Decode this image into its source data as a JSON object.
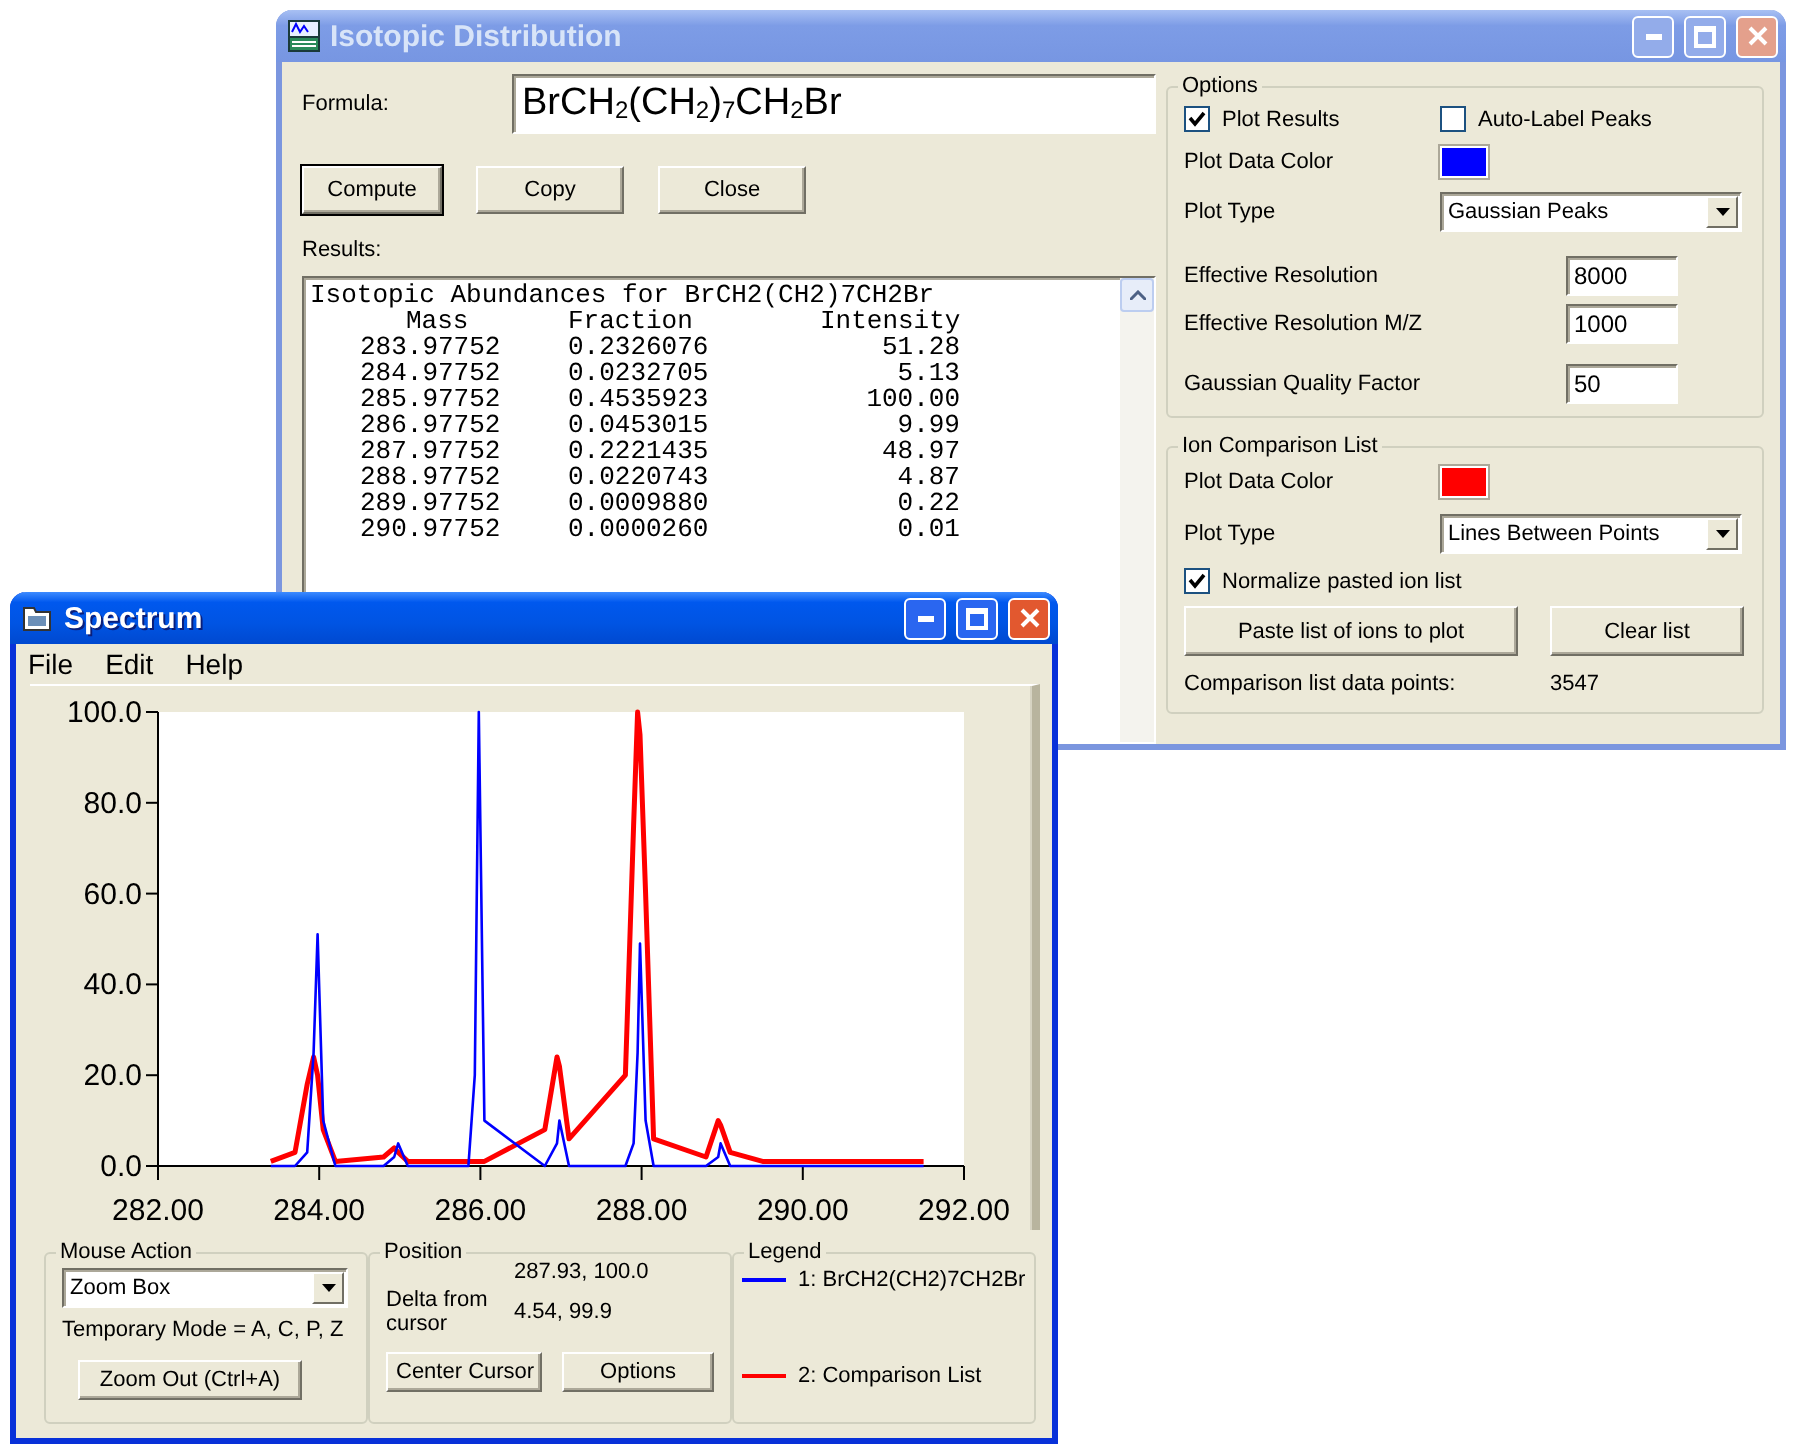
{
  "isotopic_window": {
    "title": "Isotopic Distribution",
    "active": false,
    "formula": {
      "label": "Formula:",
      "value": "BrCH$_{2}$(CH$_{2}$)$_{7}$CH$_{2}$Br"
    },
    "buttons": [
      {
        "label": "Compute",
        "default": true
      },
      {
        "label": "Copy",
        "default": false
      },
      {
        "label": "Close",
        "default": false
      }
    ],
    "results": {
      "label": "Results:",
      "heading": "Isotopic Abundances for BrCH2(CH2)7CH2Br",
      "columns": [
        "Mass",
        "Fraction",
        "Intensity"
      ],
      "rows": [
        [
          "283.97752",
          "0.2326076",
          "51.28"
        ],
        [
          "284.97752",
          "0.0232705",
          "5.13"
        ],
        [
          "285.97752",
          "0.4535923",
          "100.00"
        ],
        [
          "286.97752",
          "0.0453015",
          "9.99"
        ],
        [
          "287.97752",
          "0.2221435",
          "48.97"
        ],
        [
          "288.97752",
          "0.0220743",
          "4.87"
        ],
        [
          "289.97752",
          "0.0009880",
          "0.22"
        ],
        [
          "290.97752",
          "0.0000260",
          "0.01"
        ]
      ]
    },
    "options": {
      "title": "Options",
      "plot_results": {
        "label": "Plot Results",
        "checked": true
      },
      "auto_label": {
        "label": "Auto-Label Peaks",
        "checked": false
      },
      "plot_color": {
        "label": "Plot Data Color",
        "color": "#0000ff"
      },
      "plot_type": {
        "label": "Plot Type",
        "value": "Gaussian Peaks"
      },
      "fields": [
        {
          "label": "Effective Resolution",
          "value": "8000"
        },
        {
          "label": "Effective Resolution M/Z",
          "value": "1000"
        },
        {
          "label": "Gaussian Quality Factor",
          "value": "50"
        }
      ]
    },
    "ion_comparison": {
      "title": "Ion Comparison List",
      "plot_color": {
        "label": "Plot Data Color",
        "color": "#ff0000"
      },
      "plot_type": {
        "label": "Plot Type",
        "value": "Lines Between Points"
      },
      "normalize": {
        "label": "Normalize pasted ion list",
        "checked": true
      },
      "buttons": [
        "Paste list of ions to plot",
        "Clear list"
      ],
      "points": {
        "label": "Comparison list data points:",
        "value": "3547"
      }
    }
  },
  "spectrum_window": {
    "title": "Spectrum",
    "active": true,
    "menu": [
      "File",
      "Edit",
      "Help"
    ],
    "chart_data": {
      "type": "line",
      "xlim": [
        282,
        292
      ],
      "ylim": [
        0,
        100
      ],
      "xticks": [
        {
          "value": 282,
          "label": "282.00"
        },
        {
          "value": 284,
          "label": "284.00"
        },
        {
          "value": 286,
          "label": "286.00"
        },
        {
          "value": 288,
          "label": "288.00"
        },
        {
          "value": 290,
          "label": "290.00"
        },
        {
          "value": 292,
          "label": "292.00"
        }
      ],
      "yticks": [
        {
          "value": 0,
          "label": "0.0"
        },
        {
          "value": 20,
          "label": "20.0"
        },
        {
          "value": 40,
          "label": "40.0"
        },
        {
          "value": 60,
          "label": "60.0"
        },
        {
          "value": 80,
          "label": "80.0"
        },
        {
          "value": 100,
          "label": "100.0"
        }
      ],
      "x": [
        283.4,
        283.7,
        283.85,
        283.93,
        283.98,
        284.05,
        284.2,
        284.8,
        284.93,
        284.98,
        285.1,
        285.85,
        285.93,
        285.98,
        286.05,
        286.8,
        286.95,
        286.98,
        287.1,
        287.8,
        287.9,
        287.95,
        287.98,
        288.05,
        288.15,
        288.8,
        288.95,
        288.98,
        289.1,
        289.5,
        291.5
      ],
      "series": [
        {
          "name": "1: BrCH2(CH2)7CH2Br",
          "color": "#0000ff",
          "values": [
            0,
            0,
            3,
            25,
            51,
            10,
            0,
            0,
            2,
            5,
            0,
            0,
            20,
            100,
            10,
            0,
            5,
            10,
            0,
            0,
            5,
            25,
            49,
            10,
            0,
            0,
            2,
            5,
            0,
            0,
            0
          ]
        },
        {
          "name": "2: Comparison List",
          "color": "#ff0000",
          "values": [
            1,
            3,
            18,
            24,
            20,
            8,
            1,
            2,
            4,
            3,
            1,
            1,
            1,
            1,
            1,
            8,
            24,
            22,
            6,
            20,
            75,
            100,
            95,
            60,
            6,
            2,
            10,
            9,
            3,
            1,
            1
          ]
        }
      ]
    },
    "mouse_action": {
      "title": "Mouse Action",
      "mode": "Zoom Box",
      "hint": "Temporary Mode = A, C, P, Z",
      "button": "Zoom Out (Ctrl+A)"
    },
    "position": {
      "title": "Position",
      "value": "287.93, 100.0",
      "delta_label": "Delta from cursor",
      "delta": "4.54, 99.9",
      "buttons": [
        "Center Cursor",
        "Options"
      ]
    },
    "legend": {
      "title": "Legend"
    }
  }
}
